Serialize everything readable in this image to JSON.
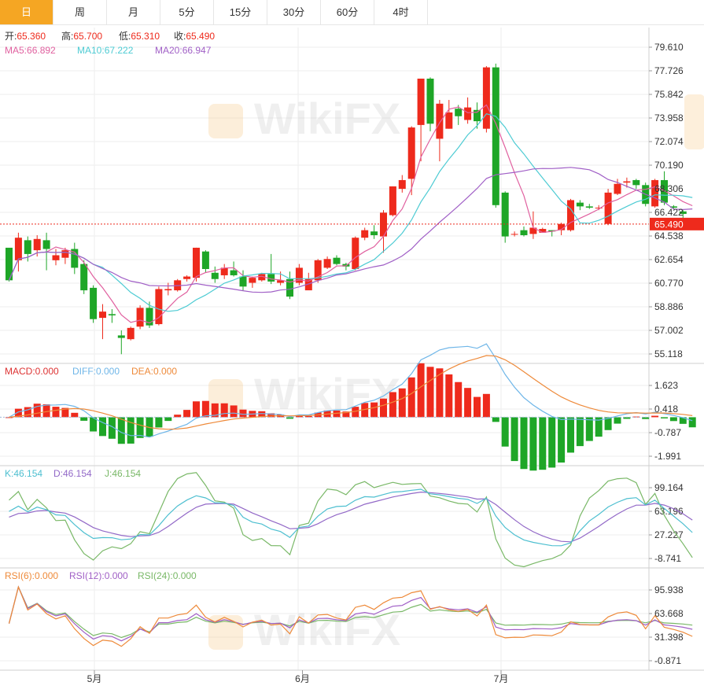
{
  "tabs": [
    {
      "label": "日",
      "active": true
    },
    {
      "label": "周",
      "active": false
    },
    {
      "label": "月",
      "active": false
    },
    {
      "label": "5分",
      "active": false
    },
    {
      "label": "15分",
      "active": false
    },
    {
      "label": "30分",
      "active": false
    },
    {
      "label": "60分",
      "active": false
    },
    {
      "label": "4时",
      "active": false
    }
  ],
  "watermark": "WikiFX",
  "colors": {
    "up": "#ee2a1c",
    "down": "#1ea627",
    "ma5": "#e0609f",
    "ma10": "#4dcbd3",
    "ma20": "#a05fc6",
    "diff": "#6fb6e8",
    "dea": "#ee8a3a",
    "k": "#4dbfd0",
    "d": "#9268c7",
    "j": "#79b867",
    "rsi6": "#ee8a3a",
    "rsi12": "#a05fc6",
    "rsi24": "#79b867",
    "price_line": "#ee2a1c"
  },
  "info": {
    "ohlc": [
      {
        "label": "开:",
        "value": "65.360"
      },
      {
        "label": "高:",
        "value": "65.700"
      },
      {
        "label": "低:",
        "value": "65.310"
      },
      {
        "label": "收:",
        "value": "65.490"
      }
    ],
    "ma": [
      {
        "label": "MA5:",
        "value": "66.892"
      },
      {
        "label": "MA10:",
        "value": "67.222"
      },
      {
        "label": "MA20:",
        "value": "66.947"
      }
    ],
    "macd": [
      {
        "label": "MACD:",
        "value": "0.000"
      },
      {
        "label": "DIFF:",
        "value": "0.000"
      },
      {
        "label": "DEA:",
        "value": "0.000"
      }
    ],
    "kdj": [
      {
        "label": "K:",
        "value": "46.154"
      },
      {
        "label": "D:",
        "value": "46.154"
      },
      {
        "label": "J:",
        "value": "46.154"
      }
    ],
    "rsi": [
      {
        "label": "RSI(6):",
        "value": "0.000"
      },
      {
        "label": "RSI(12):",
        "value": "0.000"
      },
      {
        "label": "RSI(24):",
        "value": "0.000"
      }
    ]
  },
  "chart_data": {
    "type": "candlestick",
    "last_price": "65.490",
    "x_ticks": [
      {
        "label": "5月",
        "index": 9.5
      },
      {
        "label": "6月",
        "index": 31.5
      },
      {
        "label": "7月",
        "index": 52.5
      }
    ],
    "price_axis": {
      "range": [
        55.118,
        79.61
      ],
      "ticks": [
        "79.610",
        "77.726",
        "75.842",
        "73.958",
        "72.074",
        "70.190",
        "68.306",
        "66.422",
        "64.538",
        "62.654",
        "60.770",
        "58.886",
        "57.002",
        "55.118"
      ]
    },
    "macd_axis": {
      "range": [
        -1.991,
        1.623
      ],
      "ticks": [
        "1.623",
        "0.418",
        "-0.787",
        "-1.991"
      ]
    },
    "kdj_axis": {
      "range": [
        -8.741,
        99.164
      ],
      "ticks": [
        "99.164",
        "63.196",
        "27.227",
        "-8.741"
      ]
    },
    "rsi_axis": {
      "range": [
        -0.871,
        95.938
      ],
      "ticks": [
        "95.938",
        "63.668",
        "31.398",
        "-0.871"
      ]
    },
    "ohlc": [
      [
        63.6,
        61.0,
        61.8,
        60.9
      ],
      [
        62.6,
        64.4,
        61.7,
        64.8
      ],
      [
        64.2,
        63.1,
        62.5,
        64.5
      ],
      [
        63.4,
        64.3,
        62.9,
        64.6
      ],
      [
        64.2,
        63.5,
        61.8,
        64.8
      ],
      [
        62.6,
        63.0,
        62.2,
        63.5
      ],
      [
        62.8,
        63.4,
        62.3,
        63.6
      ],
      [
        63.5,
        62.0,
        61.5,
        64.0
      ],
      [
        62.3,
        60.2,
        59.9,
        62.6
      ],
      [
        60.4,
        57.9,
        57.6,
        60.6
      ],
      [
        58.0,
        58.5,
        56.3,
        59.1
      ],
      [
        58.3,
        58.2,
        57.6,
        58.7
      ],
      [
        56.6,
        56.4,
        55.1,
        57.0
      ],
      [
        56.3,
        57.2,
        56.2,
        57.3
      ],
      [
        57.3,
        58.8,
        57.1,
        59.0
      ],
      [
        58.8,
        57.4,
        57.2,
        59.3
      ],
      [
        57.5,
        60.3,
        57.4,
        60.5
      ],
      [
        60.2,
        60.3,
        59.8,
        60.8
      ],
      [
        60.2,
        61.0,
        60.1,
        61.1
      ],
      [
        61.1,
        61.3,
        60.9,
        61.4
      ],
      [
        61.2,
        63.6,
        60.9,
        63.6
      ],
      [
        63.3,
        61.9,
        61.6,
        63.4
      ],
      [
        61.6,
        61.1,
        60.8,
        62.1
      ],
      [
        61.4,
        62.0,
        61.1,
        62.3
      ],
      [
        61.8,
        61.4,
        61.3,
        62.5
      ],
      [
        61.3,
        60.5,
        60.2,
        61.8
      ],
      [
        60.8,
        61.2,
        60.4,
        61.3
      ],
      [
        61.0,
        61.5,
        60.9,
        61.6
      ],
      [
        61.5,
        60.9,
        60.7,
        63.1
      ],
      [
        60.8,
        61.0,
        60.6,
        61.7
      ],
      [
        61.1,
        59.7,
        59.5,
        61.7
      ],
      [
        60.8,
        62.0,
        60.6,
        62.3
      ],
      [
        60.2,
        61.1,
        60.9,
        61.6
      ],
      [
        61.0,
        62.6,
        60.8,
        62.7
      ],
      [
        62.0,
        62.7,
        61.9,
        62.9
      ],
      [
        62.8,
        62.3,
        62.2,
        63.0
      ],
      [
        62.3,
        62.1,
        61.8,
        62.4
      ],
      [
        61.9,
        64.4,
        61.8,
        64.5
      ],
      [
        64.4,
        65.0,
        64.2,
        65.2
      ],
      [
        64.9,
        64.6,
        64.3,
        65.4
      ],
      [
        64.5,
        66.4,
        63.2,
        66.6
      ],
      [
        66.2,
        68.5,
        66.1,
        68.5
      ],
      [
        68.3,
        69.0,
        68.0,
        69.4
      ],
      [
        69.1,
        73.2,
        67.8,
        73.3
      ],
      [
        73.4,
        77.1,
        70.5,
        77.1
      ],
      [
        77.1,
        73.5,
        72.9,
        77.2
      ],
      [
        72.3,
        75.1,
        70.5,
        75.4
      ],
      [
        73.1,
        74.4,
        73.1,
        75.4
      ],
      [
        74.7,
        74.1,
        73.4,
        75.0
      ],
      [
        73.8,
        74.8,
        73.5,
        75.6
      ],
      [
        74.6,
        73.7,
        73.1,
        75.2
      ],
      [
        73.1,
        78.0,
        72.8,
        78.1
      ],
      [
        78.0,
        67.0,
        66.8,
        78.3
      ],
      [
        68.0,
        64.5,
        64.0,
        68.1
      ],
      [
        64.7,
        64.7,
        64.5,
        64.9
      ],
      [
        65.0,
        64.6,
        64.5,
        65.3
      ],
      [
        64.7,
        65.2,
        64.3,
        66.5
      ],
      [
        64.8,
        65.1,
        64.8,
        65.2
      ],
      [
        65.0,
        64.9,
        64.5,
        65.0
      ],
      [
        65.0,
        65.5,
        64.6,
        65.6
      ],
      [
        65.0,
        67.4,
        64.9,
        67.5
      ],
      [
        67.2,
        66.9,
        66.6,
        67.4
      ],
      [
        66.9,
        66.8,
        66.7,
        67.1
      ],
      [
        66.8,
        66.8,
        66.6,
        67.0
      ],
      [
        65.5,
        68.0,
        65.4,
        68.3
      ],
      [
        67.9,
        68.7,
        67.8,
        69.1
      ],
      [
        68.8,
        68.9,
        68.4,
        69.2
      ],
      [
        69.0,
        68.6,
        68.3,
        69.1
      ],
      [
        68.6,
        67.1,
        66.9,
        68.8
      ],
      [
        66.9,
        69.0,
        66.8,
        69.1
      ],
      [
        69.0,
        67.2,
        67.0,
        69.7
      ],
      [
        66.9,
        66.8,
        66.7,
        67.0
      ],
      [
        66.5,
        66.3,
        65.7,
        66.6
      ],
      [
        65.36,
        65.49,
        65.31,
        65.7
      ]
    ]
  }
}
